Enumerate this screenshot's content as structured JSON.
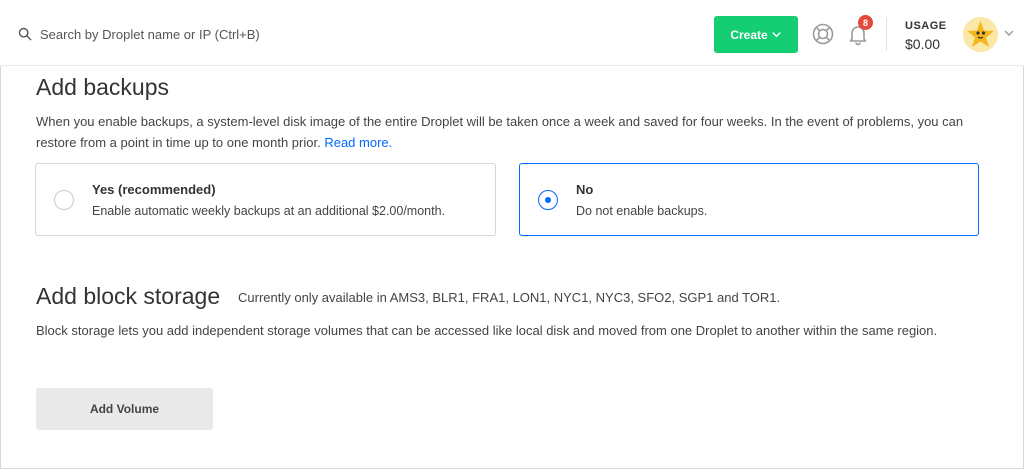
{
  "header": {
    "search_placeholder": "Search by Droplet name or IP (Ctrl+B)",
    "create_label": "Create",
    "notification_count": "8",
    "usage_label": "USAGE",
    "usage_value": "$0.00"
  },
  "backups": {
    "title": "Add backups",
    "description": "When you enable backups, a system-level disk image of the entire Droplet will be taken once a week and saved for four weeks. In the event of problems, you can restore from a point in time up to one month prior.",
    "read_more": "Read more.",
    "options": [
      {
        "title": "Yes (recommended)",
        "subtitle": "Enable automatic weekly backups at an additional $2.00/month.",
        "selected": false
      },
      {
        "title": "No",
        "subtitle": "Do not enable backups.",
        "selected": true
      }
    ]
  },
  "block_storage": {
    "title": "Add block storage",
    "availability": "Currently only available in AMS3, BLR1, FRA1, LON1, NYC1, NYC3, SFO2, SGP1 and TOR1.",
    "description": "Block storage lets you add independent storage volumes that can be accessed like local disk and moved from one Droplet to another within the same region.",
    "add_volume_label": "Add Volume"
  },
  "colors": {
    "accent": "#0069ff",
    "create_button": "#15cd72",
    "badge": "#e5493a"
  },
  "icons": [
    "search-icon",
    "chevron-down-icon",
    "help-lifebuoy-icon",
    "bell-icon",
    "avatar-starfish",
    "chevron-down-icon"
  ]
}
